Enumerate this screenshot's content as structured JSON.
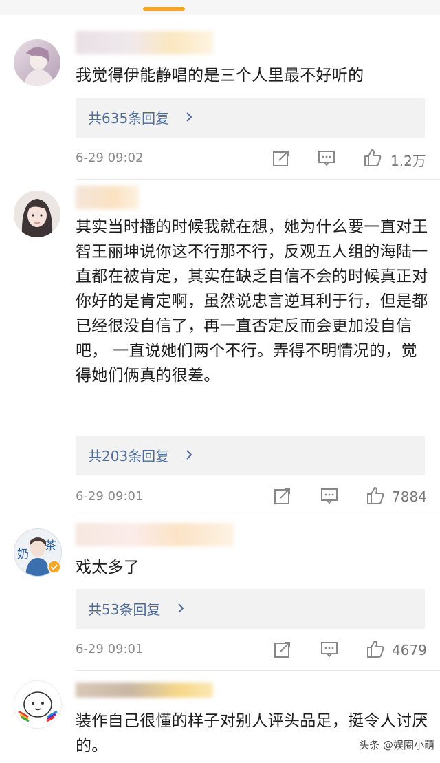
{
  "colors": {
    "accent": "#f5a623",
    "reply_link": "#4f6c97",
    "meta_text": "#8a8a8a"
  },
  "comments": [
    {
      "text": "我觉得伊能静唱的是三个人里最不好听的",
      "replies": "共635条回复",
      "time": "6-29 09:02",
      "likes": "1.2万"
    },
    {
      "text": "其实当时播的时候我就在想，她为什么要一直对王智王丽坤说你这不行那不行，反观五人组的海陆一直都在被肯定，其实在缺乏自信不会的时候真正对你好的是肯定啊，虽然说忠言逆耳利于行，但是都已经很没自信了，再一直否定反而会更加没自信吧， 一直说她们两个不行。弄得不明情况的，觉得她们俩真的很差。",
      "replies": "共203条回复",
      "time": "6-29 09:01",
      "likes": "7884"
    },
    {
      "text": "戏太多了",
      "replies": "共53条回复",
      "time": "6-29 09:01",
      "likes": "4679",
      "avatar_text_left": "奶",
      "avatar_text_right": "茶"
    },
    {
      "text": "装作自己很懂的样子对别人评头品足，挺令人讨厌的。"
    }
  ],
  "icons": [
    "share-icon",
    "comment-icon",
    "like-icon",
    "chevron-right-icon",
    "verified-badge-icon"
  ],
  "watermark": "头条 @娱圈小萌"
}
